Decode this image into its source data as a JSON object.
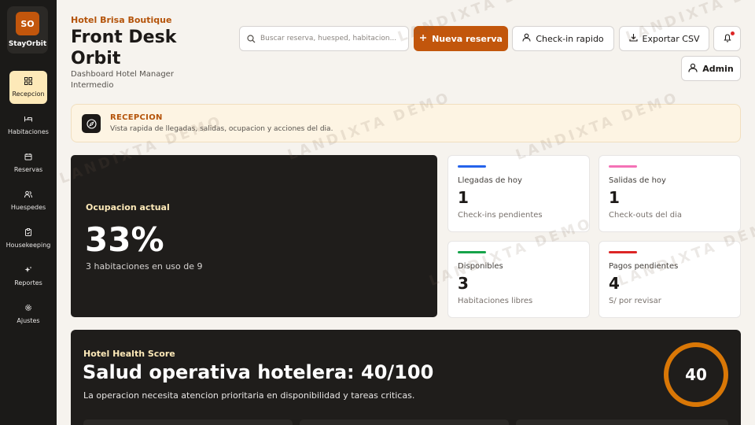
{
  "brand": {
    "logo": "SO",
    "name": "StayOrbit"
  },
  "nav": [
    {
      "label": "Recepcion",
      "icon": "grid-icon",
      "active": true
    },
    {
      "label": "Habitaciones",
      "icon": "bed-icon"
    },
    {
      "label": "Reservas",
      "icon": "calendar-icon"
    },
    {
      "label": "Huespedes",
      "icon": "users-icon"
    },
    {
      "label": "Housekeeping",
      "icon": "clipboard-icon"
    },
    {
      "label": "Reportes",
      "icon": "sparkle-icon"
    },
    {
      "label": "Ajustes",
      "icon": "gear-icon"
    }
  ],
  "header": {
    "hotel": "Hotel Brisa Boutique",
    "title": "Front Desk Orbit",
    "subtitle": "Dashboard Hotel Manager Intermedio"
  },
  "search": {
    "placeholder": "Buscar reserva, huesped, habitacion..."
  },
  "actions": {
    "new_booking": "Nueva reserva",
    "checkin": "Check-in rapido",
    "export": "Exportar CSV",
    "admin": "Admin"
  },
  "banner": {
    "title": "RECEPCION",
    "text": "Vista rapida de llegadas, salidas, ocupacion y acciones del dia."
  },
  "occupancy": {
    "label": "Ocupacion actual",
    "value": "33%",
    "sub": "3 habitaciones en uso de 9"
  },
  "stats": [
    {
      "label": "Llegadas de hoy",
      "value": "1",
      "sub": "Check-ins pendientes",
      "color": "#2563eb"
    },
    {
      "label": "Salidas de hoy",
      "value": "1",
      "sub": "Check-outs del dia",
      "color": "#f472b6"
    },
    {
      "label": "Disponibles",
      "value": "3",
      "sub": "Habitaciones libres",
      "color": "#16a34a"
    },
    {
      "label": "Pagos pendientes",
      "value": "4",
      "sub": "S/ por revisar",
      "color": "#dc2626"
    }
  ],
  "health": {
    "label": "Hotel Health Score",
    "title": "Salud operativa hotelera: 40/100",
    "sub": "La operacion necesita atencion prioritaria en disponibilidad y tareas criticas.",
    "score": "40",
    "score_value": 40,
    "ring_color": "#d97706"
  },
  "watermark": "LANDIXTA DEMO"
}
